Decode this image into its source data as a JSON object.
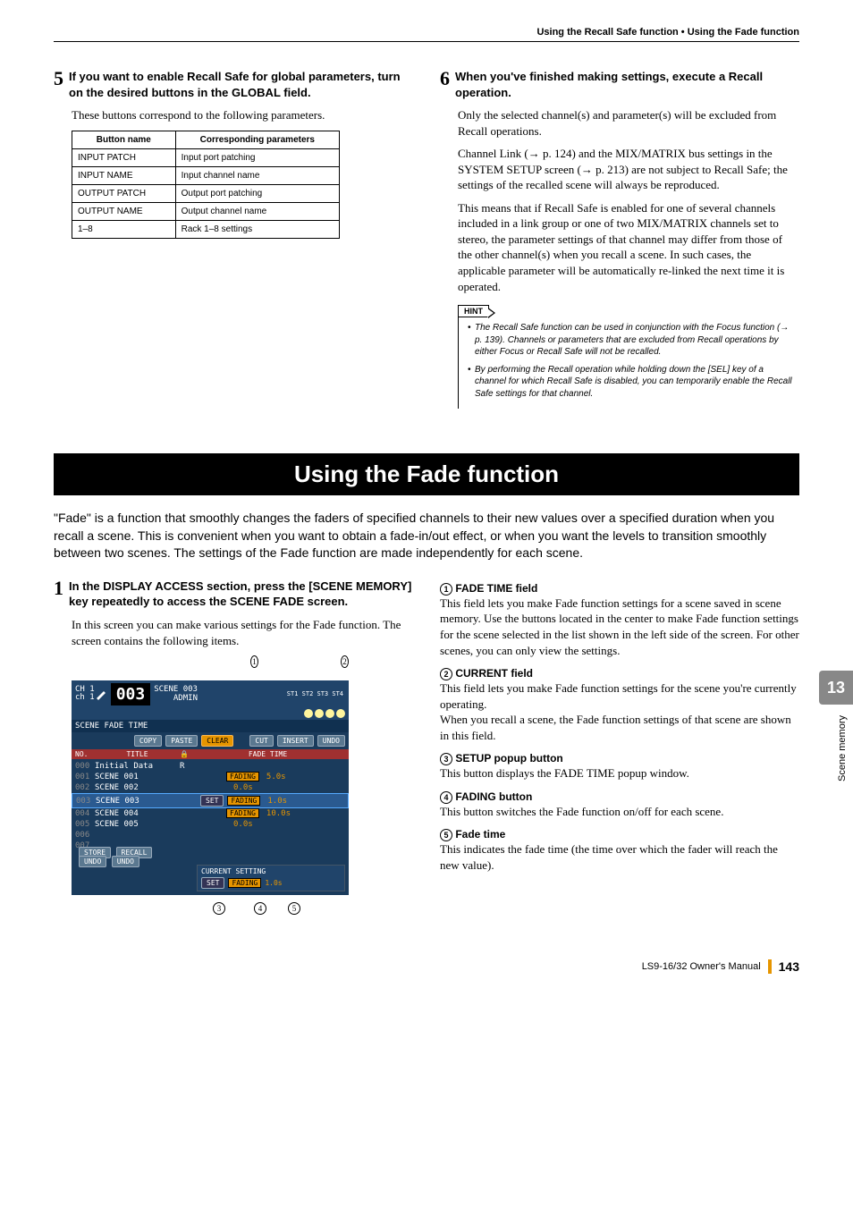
{
  "header": "Using the Recall Safe function • Using the Fade function",
  "side_tab": "13",
  "side_text": "Scene memory",
  "step5": {
    "num": "5",
    "title": "If you want to enable Recall Safe for global parameters, turn on the desired buttons in the GLOBAL field.",
    "body": "These buttons correspond to the following parameters.",
    "table": {
      "h1": "Button name",
      "h2": "Corresponding parameters",
      "rows": [
        {
          "a": "INPUT PATCH",
          "b": "Input port patching"
        },
        {
          "a": "INPUT NAME",
          "b": "Input channel name"
        },
        {
          "a": "OUTPUT PATCH",
          "b": "Output port patching"
        },
        {
          "a": "OUTPUT NAME",
          "b": "Output channel name"
        },
        {
          "a": "1–8",
          "b": "Rack 1–8 settings"
        }
      ]
    }
  },
  "step6": {
    "num": "6",
    "title": "When you've finished making settings, execute a Recall operation.",
    "body1": "Only the selected channel(s) and parameter(s) will be excluded from Recall operations.",
    "body2": "Channel Link (→ p. 124) and the MIX/MATRIX bus settings in the SYSTEM SETUP screen (→ p. 213) are not subject to Recall Safe; the settings of the recalled scene will always be reproduced.",
    "body3": "This means that if Recall Safe is enabled for one of several channels included in a link group or one of two MIX/MATRIX channels set to stereo, the parameter settings of that channel may differ from those of the other channel(s) when you recall a scene. In such cases, the applicable parameter will be automatically re-linked the next time it is operated.",
    "hint_label": "HINT",
    "hint1": "The Recall Safe function can be used in conjunction with the Focus function (→ p. 139). Channels or parameters that are excluded from Recall operations by either Focus or Recall Safe will not be recalled.",
    "hint2": "By performing the Recall operation while holding down the [SEL] key of a channel for which Recall Safe is disabled, you can temporarily enable the Recall Safe settings for that channel."
  },
  "section_title": "Using the Fade function",
  "intro": "\"Fade\" is a function that smoothly changes the faders of specified channels to their new values over a specified duration when you recall a scene. This is convenient when you want to obtain a fade-in/out effect, or when you want the levels to transition smoothly between two scenes. The settings of the Fade function are made independently for each scene.",
  "step1": {
    "num": "1",
    "title": "In the DISPLAY ACCESS section, press the [SCENE MEMORY] key repeatedly to access the SCENE FADE screen.",
    "body": "In this screen you can make various settings for the Fade function. The screen contains the following items."
  },
  "screenshot": {
    "ch": "CH 1",
    "ch2": "ch 1",
    "num": "003",
    "scene": "SCENE 003",
    "admin": "ADMIN",
    "st_labels": "ST1 ST2 ST3 ST4",
    "sub": "SCENE FADE TIME",
    "btns": {
      "copy": "COPY",
      "paste": "PASTE",
      "clear": "CLEAR",
      "cut": "CUT",
      "insert": "INSERT",
      "undo": "UNDO"
    },
    "cols": {
      "no": "NO.",
      "title": "TITLE",
      "fade": "FADE TIME"
    },
    "rows": [
      {
        "idx": "000",
        "name": "Initial Data",
        "lock": "R",
        "fad": "",
        "time": ""
      },
      {
        "idx": "001",
        "name": "SCENE 001",
        "lock": "",
        "fad": "FADING",
        "time": "5.0s"
      },
      {
        "idx": "002",
        "name": "SCENE 002",
        "lock": "",
        "fad": "",
        "time": "0.0s"
      },
      {
        "idx": "003",
        "name": "SCENE 003",
        "lock": "",
        "fad": "FADING",
        "time": "1.0s",
        "sel": true,
        "set": "SET"
      },
      {
        "idx": "004",
        "name": "SCENE 004",
        "lock": "",
        "fad": "FADING",
        "time": "10.0s"
      },
      {
        "idx": "005",
        "name": "SCENE 005",
        "lock": "",
        "fad": "",
        "time": "0.0s"
      },
      {
        "idx": "006",
        "name": "",
        "lock": "",
        "fad": "",
        "time": ""
      },
      {
        "idx": "007",
        "name": "",
        "lock": "",
        "fad": "",
        "time": ""
      }
    ],
    "store": "STORE",
    "recall": "RECALL",
    "undo1": "UNDO",
    "undo2": "UNDO",
    "current": "CURRENT SETTING",
    "set": "SET",
    "fading": "FADING",
    "time": "1.0s"
  },
  "callouts": {
    "c1": "1",
    "c2": "2",
    "c3": "3",
    "c4": "4",
    "c5": "5"
  },
  "desc": {
    "d1": {
      "n": "1",
      "label": "FADE TIME field",
      "text": "This field lets you make Fade function settings for a scene saved in scene memory. Use the buttons located in the center to make Fade function settings for the scene selected in the list shown in the left side of the screen. For other scenes, you can only view the settings."
    },
    "d2": {
      "n": "2",
      "label": "CURRENT field",
      "text": "This field lets you make Fade function settings for the scene you're currently operating.",
      "text2": "When you recall a scene, the Fade function settings of that scene are shown in this field."
    },
    "d3": {
      "n": "3",
      "label": "SETUP popup button",
      "text": "This button displays the FADE TIME popup window."
    },
    "d4": {
      "n": "4",
      "label": "FADING button",
      "text": "This button switches the Fade function on/off for each scene."
    },
    "d5": {
      "n": "5",
      "label": "Fade time",
      "text": "This indicates the fade time (the time over which the fader will reach the new value)."
    }
  },
  "footer": {
    "manual": "LS9-16/32  Owner's Manual",
    "page": "143"
  }
}
